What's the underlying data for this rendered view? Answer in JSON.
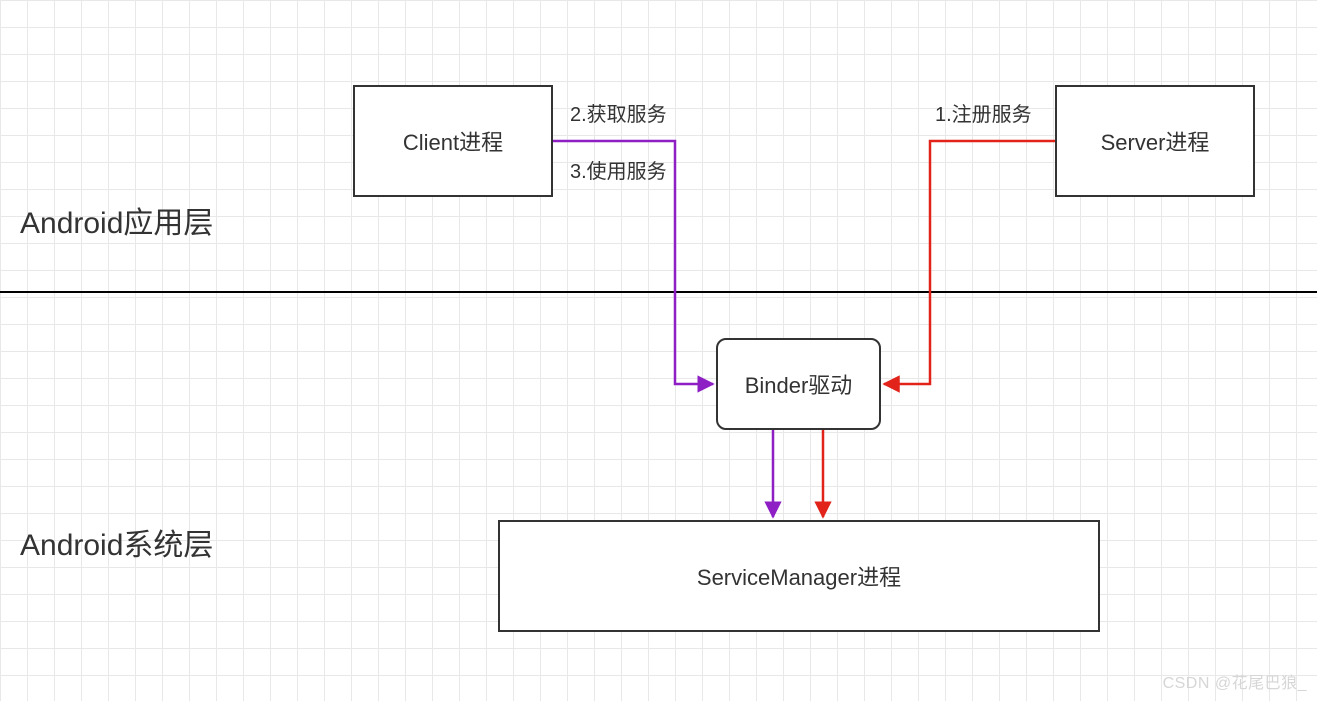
{
  "sections": {
    "app_layer": "Android应用层",
    "system_layer": "Android系统层"
  },
  "boxes": {
    "client": "Client进程",
    "server": "Server进程",
    "binder": "Binder驱动",
    "service_manager": "ServiceManager进程"
  },
  "labels": {
    "step1": "1.注册服务",
    "step2": "2.获取服务",
    "step3": "3.使用服务"
  },
  "colors": {
    "register_arrow": "#e2231a",
    "client_arrow": "#8e1fc4",
    "box_border": "#333333"
  },
  "watermark": "CSDN @花尾巴狼_"
}
